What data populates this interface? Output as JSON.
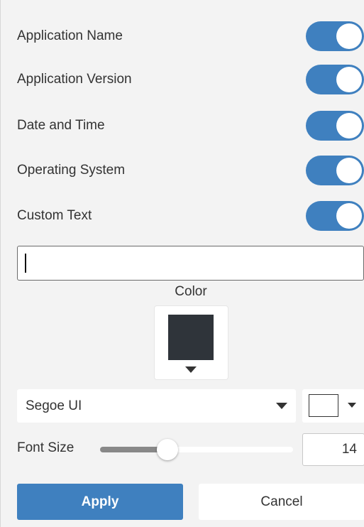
{
  "toggles": [
    {
      "label": "Application Name",
      "on": true
    },
    {
      "label": "Application Version",
      "on": true
    },
    {
      "label": "Date and Time",
      "on": true
    },
    {
      "label": "Operating System",
      "on": true
    },
    {
      "label": "Custom Text",
      "on": true
    }
  ],
  "custom_text": {
    "value": "",
    "placeholder": ""
  },
  "color": {
    "label": "Color",
    "value": "#2f343a"
  },
  "font": {
    "family": "Segoe UI",
    "text_color": "#ffffff"
  },
  "font_size": {
    "label": "Font Size",
    "value": "14",
    "slider_fraction": 0.35
  },
  "buttons": {
    "apply": "Apply",
    "cancel": "Cancel"
  },
  "colors": {
    "accent": "#3f80bf",
    "panel_bg": "#f3f3f3"
  }
}
